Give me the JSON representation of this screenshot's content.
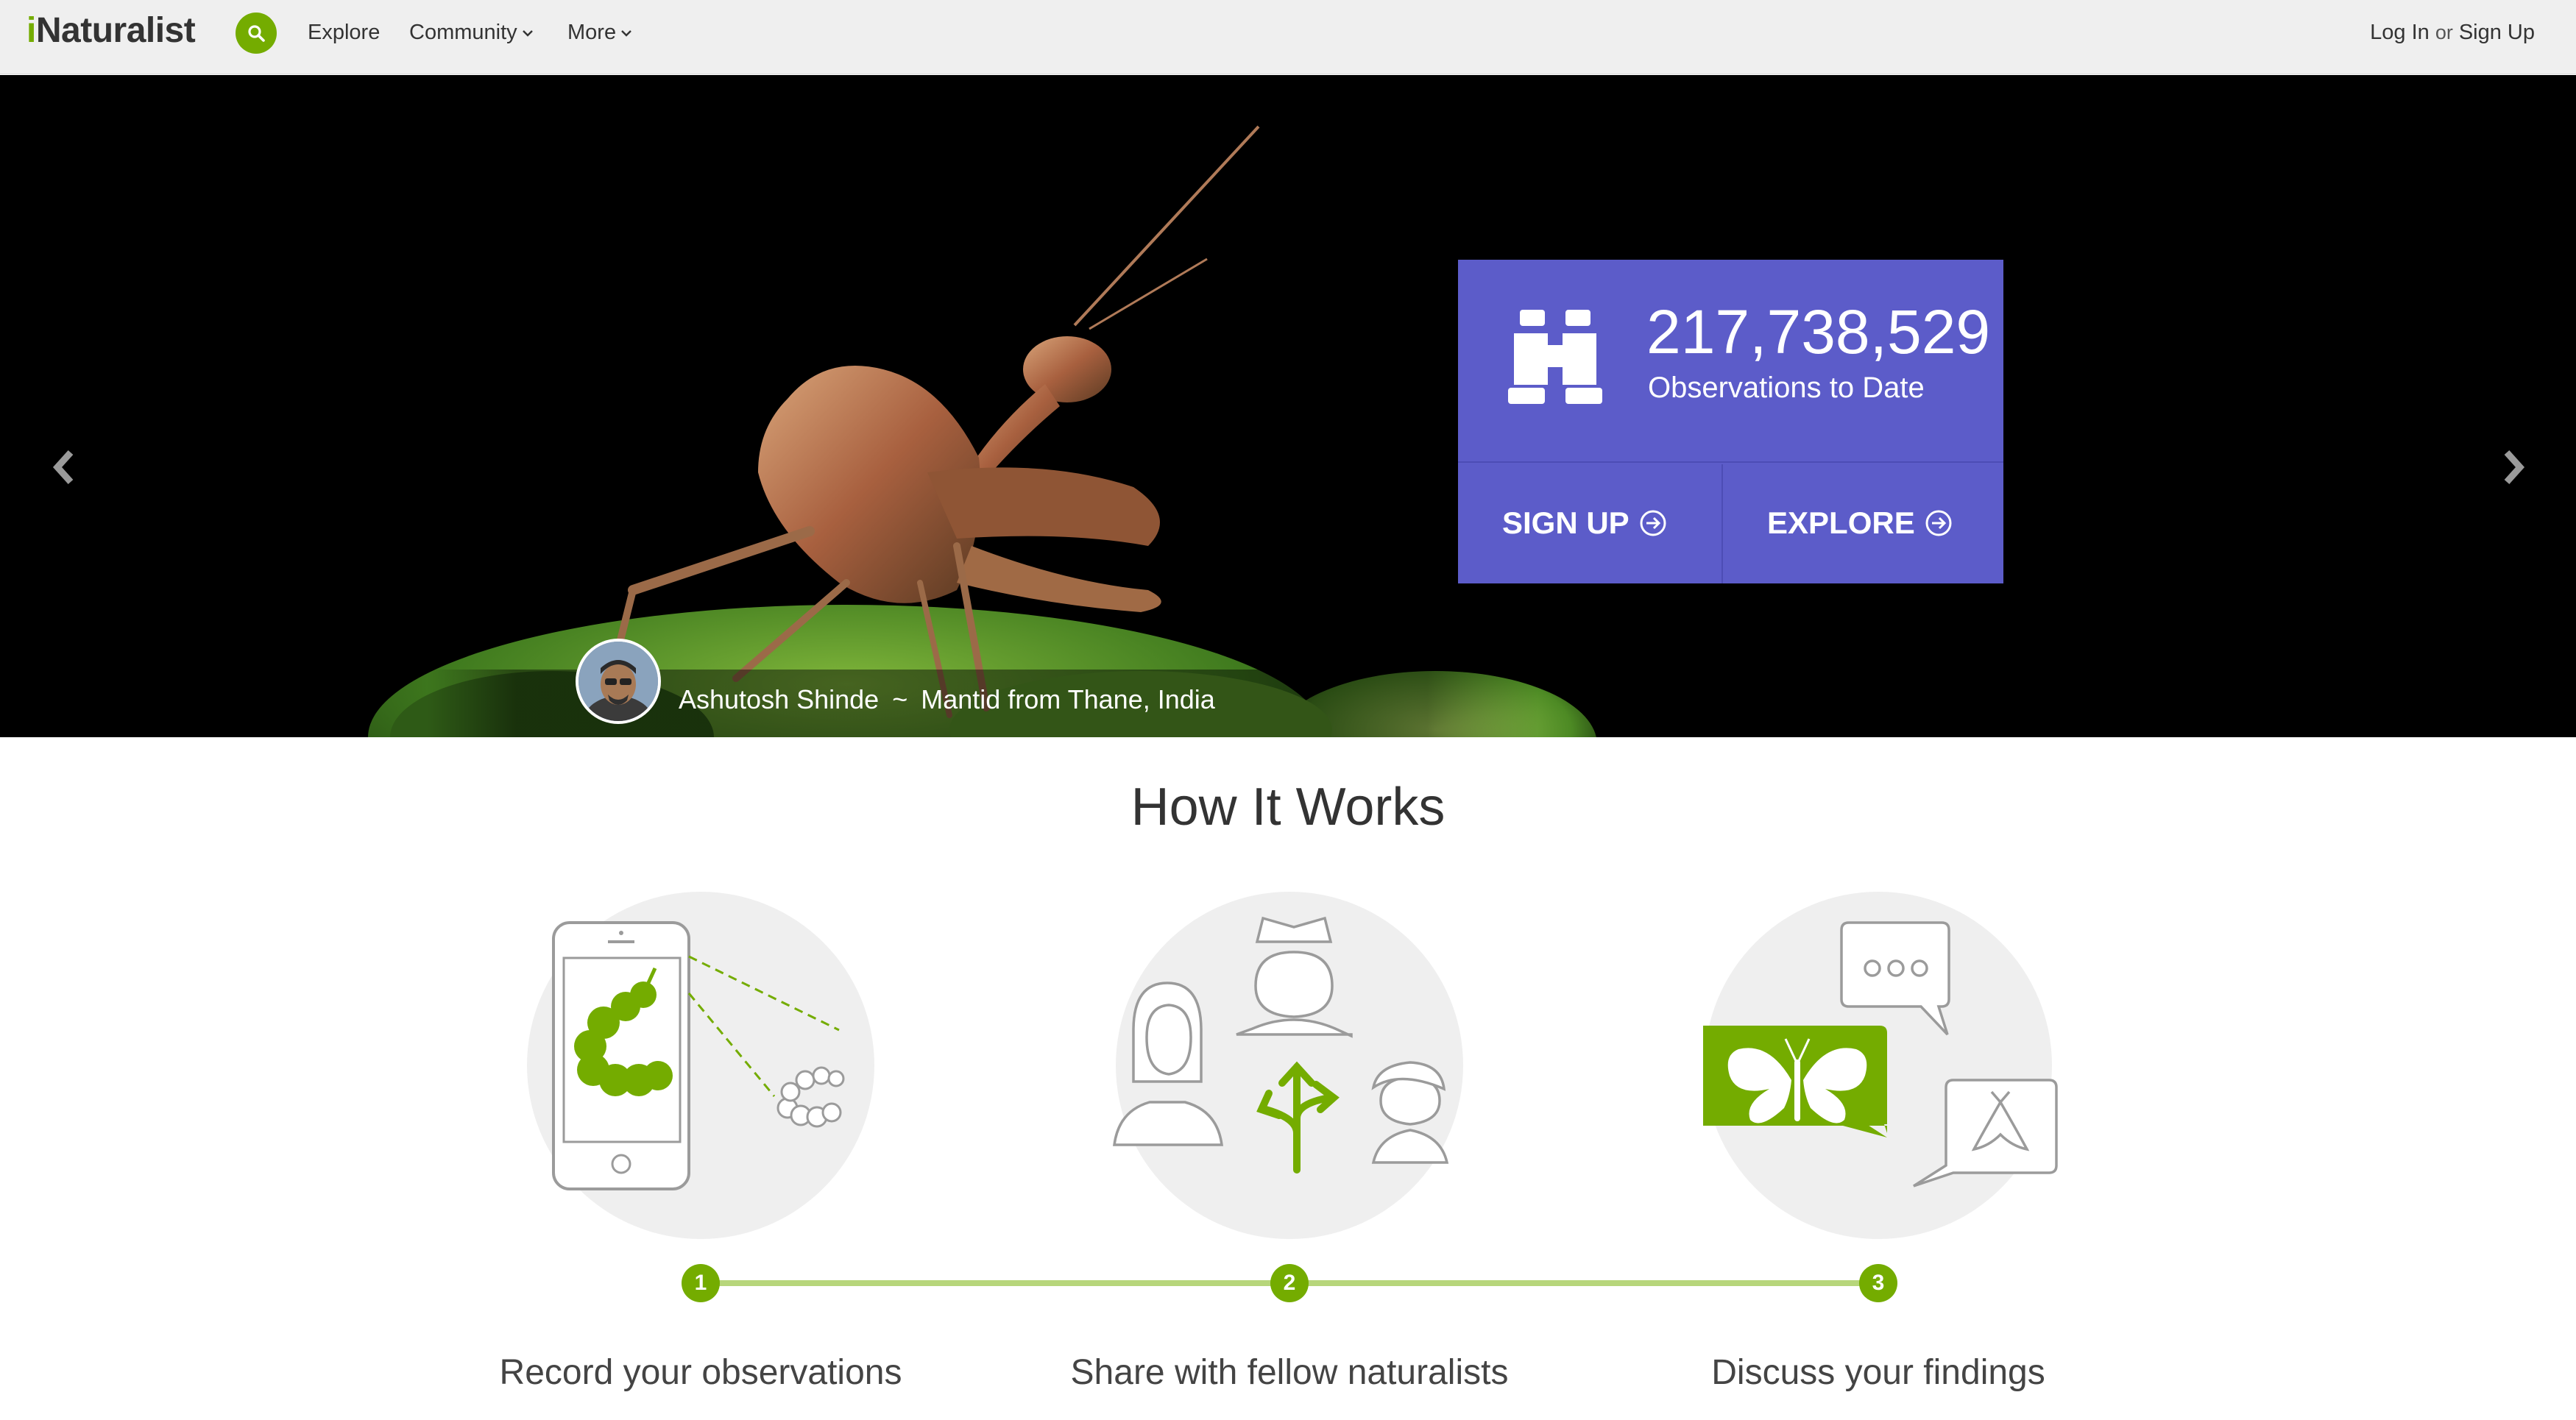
{
  "header": {
    "logo_i": "i",
    "logo_rest": "Naturalist",
    "nav": [
      {
        "label": "Explore"
      },
      {
        "label": "Community"
      },
      {
        "label": "More"
      }
    ],
    "login_label": "Log In",
    "or_label": "or",
    "signup_label": "Sign Up"
  },
  "hero": {
    "observation_count": "217,738,529",
    "observation_label": "Observations to Date",
    "signup_cta": "SIGN UP",
    "explore_cta": "EXPLORE",
    "photographer": "Ashutosh Shinde",
    "separator": "~",
    "photo_caption": "Mantid from Thane, India",
    "accent_color": "#5c5cc9"
  },
  "how_it_works": {
    "title": "How It Works",
    "steps": [
      {
        "number": "1",
        "label": "Record your observations"
      },
      {
        "number": "2",
        "label": "Share with fellow naturalists"
      },
      {
        "number": "3",
        "label": "Discuss your findings"
      }
    ],
    "brand_color": "#74ac00"
  },
  "icons": [
    "search-icon",
    "chevron-down-icon",
    "binoculars-icon",
    "arrow-circle-right-icon",
    "chevron-left-icon",
    "chevron-right-icon",
    "phone-icon",
    "caterpillar-icon",
    "person-icon",
    "tree-branch-icon",
    "speech-bubble-icon",
    "butterfly-icon",
    "moth-icon"
  ]
}
